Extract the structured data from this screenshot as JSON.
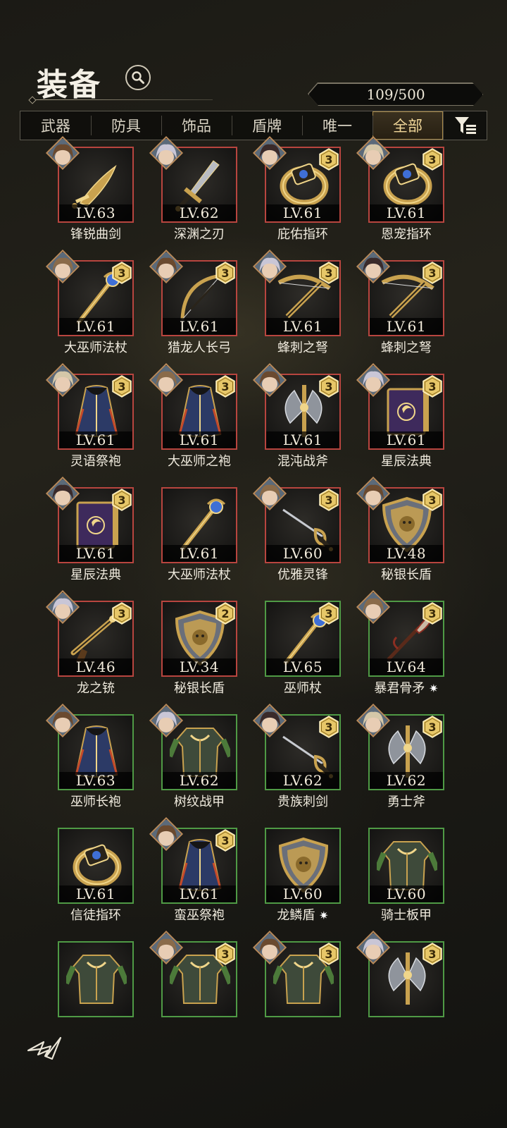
{
  "header": {
    "title": "装备",
    "capacity": "109/500"
  },
  "tabs": [
    {
      "label": "武器",
      "active": false
    },
    {
      "label": "防具",
      "active": false
    },
    {
      "label": "饰品",
      "active": false
    },
    {
      "label": "盾牌",
      "active": false
    },
    {
      "label": "唯一",
      "active": false
    },
    {
      "label": "全部",
      "active": true
    }
  ],
  "colors": {
    "rarity_red": "#b8453f",
    "rarity_green": "#4f9a45",
    "active_tab": "#f2d89a",
    "badge_gold": "#e7c768"
  },
  "items": [
    {
      "name": "锋锐曲剑",
      "level": "LV.63",
      "rarity": "red",
      "badge": "",
      "avatar": true,
      "icon": "curved-sword"
    },
    {
      "name": "深渊之刃",
      "level": "LV.62",
      "rarity": "red",
      "badge": "",
      "avatar": true,
      "icon": "dagger"
    },
    {
      "name": "庇佑指环",
      "level": "LV.61",
      "rarity": "red",
      "badge": "3",
      "avatar": true,
      "icon": "ring"
    },
    {
      "name": "恩宠指环",
      "level": "LV.61",
      "rarity": "red",
      "badge": "3",
      "avatar": true,
      "icon": "ring"
    },
    {
      "name": "大巫师法杖",
      "level": "LV.61",
      "rarity": "red",
      "badge": "3",
      "avatar": true,
      "icon": "staff"
    },
    {
      "name": "猎龙人长弓",
      "level": "LV.61",
      "rarity": "red",
      "badge": "3",
      "avatar": true,
      "icon": "bow"
    },
    {
      "name": "蜂刺之弩",
      "level": "LV.61",
      "rarity": "red",
      "badge": "3",
      "avatar": true,
      "icon": "crossbow"
    },
    {
      "name": "蜂刺之弩",
      "level": "LV.61",
      "rarity": "red",
      "badge": "3",
      "avatar": true,
      "icon": "crossbow"
    },
    {
      "name": "灵语祭袍",
      "level": "LV.61",
      "rarity": "red",
      "badge": "3",
      "avatar": true,
      "icon": "robe"
    },
    {
      "name": "大巫师之袍",
      "level": "LV.61",
      "rarity": "red",
      "badge": "3",
      "avatar": true,
      "icon": "robe"
    },
    {
      "name": "混沌战斧",
      "level": "LV.61",
      "rarity": "red",
      "badge": "3",
      "avatar": true,
      "icon": "axe"
    },
    {
      "name": "星辰法典",
      "level": "LV.61",
      "rarity": "red",
      "badge": "3",
      "avatar": true,
      "icon": "tome"
    },
    {
      "name": "星辰法典",
      "level": "LV.61",
      "rarity": "red",
      "badge": "3",
      "avatar": true,
      "icon": "tome"
    },
    {
      "name": "大巫师法杖",
      "level": "LV.61",
      "rarity": "red",
      "badge": "",
      "avatar": false,
      "icon": "staff"
    },
    {
      "name": "优雅灵锋",
      "level": "LV.60",
      "rarity": "red",
      "badge": "3",
      "avatar": true,
      "icon": "rapier"
    },
    {
      "name": "秘银长盾",
      "level": "LV.48",
      "rarity": "red",
      "badge": "3",
      "avatar": true,
      "icon": "shield"
    },
    {
      "name": "龙之铳",
      "level": "LV.46",
      "rarity": "red",
      "badge": "3",
      "avatar": true,
      "icon": "gun"
    },
    {
      "name": "秘银长盾",
      "level": "LV.34",
      "rarity": "red",
      "badge": "2",
      "avatar": false,
      "icon": "shield"
    },
    {
      "name": "巫师杖",
      "level": "LV.65",
      "rarity": "green",
      "badge": "3",
      "avatar": false,
      "icon": "staff"
    },
    {
      "name": "暴君骨矛",
      "level": "LV.64",
      "rarity": "green",
      "badge": "3",
      "avatar": true,
      "icon": "spear",
      "spark": "✷"
    },
    {
      "name": "巫师长袍",
      "level": "LV.63",
      "rarity": "green",
      "badge": "",
      "avatar": true,
      "icon": "robe"
    },
    {
      "name": "树纹战甲",
      "level": "LV.62",
      "rarity": "green",
      "badge": "",
      "avatar": true,
      "icon": "armor"
    },
    {
      "name": "贵族刺剑",
      "level": "LV.62",
      "rarity": "green",
      "badge": "3",
      "avatar": true,
      "icon": "rapier"
    },
    {
      "name": "勇士斧",
      "level": "LV.62",
      "rarity": "green",
      "badge": "3",
      "avatar": true,
      "icon": "axe"
    },
    {
      "name": "信徒指环",
      "level": "LV.61",
      "rarity": "green",
      "badge": "",
      "avatar": false,
      "icon": "ring"
    },
    {
      "name": "蛮巫祭袍",
      "level": "LV.61",
      "rarity": "green",
      "badge": "3",
      "avatar": true,
      "icon": "robe"
    },
    {
      "name": "龙鳞盾",
      "level": "LV.60",
      "rarity": "green",
      "badge": "",
      "avatar": false,
      "icon": "shield",
      "spark": "✷"
    },
    {
      "name": "骑士板甲",
      "level": "LV.60",
      "rarity": "green",
      "badge": "",
      "avatar": false,
      "icon": "armor"
    },
    {
      "name": "",
      "level": "",
      "rarity": "green",
      "badge": "",
      "avatar": false,
      "icon": "armor"
    },
    {
      "name": "",
      "level": "",
      "rarity": "green",
      "badge": "3",
      "avatar": true,
      "icon": "armor"
    },
    {
      "name": "",
      "level": "",
      "rarity": "green",
      "badge": "3",
      "avatar": true,
      "icon": "armor"
    },
    {
      "name": "",
      "level": "",
      "rarity": "green",
      "badge": "3",
      "avatar": true,
      "icon": "axe"
    }
  ]
}
